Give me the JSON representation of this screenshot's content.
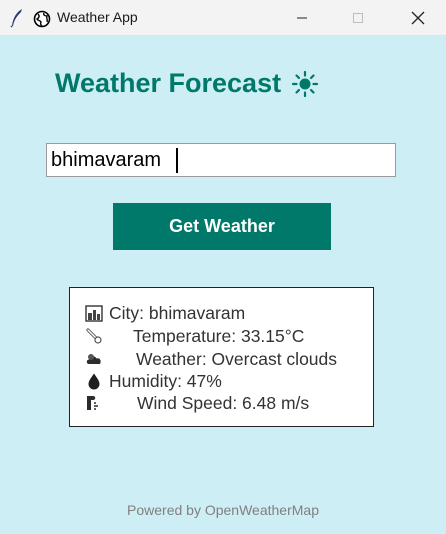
{
  "window": {
    "title": "Weather App"
  },
  "header": {
    "title": "Weather Forecast"
  },
  "search": {
    "value": "bhimavaram",
    "button_label": "Get Weather"
  },
  "result": {
    "city": "City: bhimavaram",
    "temperature": "Temperature: 33.15°C",
    "weather": "Weather: Overcast clouds",
    "humidity": "Humidity: 47%",
    "wind": "Wind Speed: 6.48 m/s"
  },
  "footer": {
    "text": "Powered by OpenWeatherMap"
  },
  "colors": {
    "accent": "#00796b",
    "background": "#cdeef4"
  },
  "icons": [
    "feather-icon",
    "globe-icon",
    "minimize-icon",
    "maximize-icon",
    "close-icon",
    "sun-icon",
    "city-icon",
    "thermometer-icon",
    "cloud-icon",
    "droplet-icon",
    "wind-icon"
  ]
}
